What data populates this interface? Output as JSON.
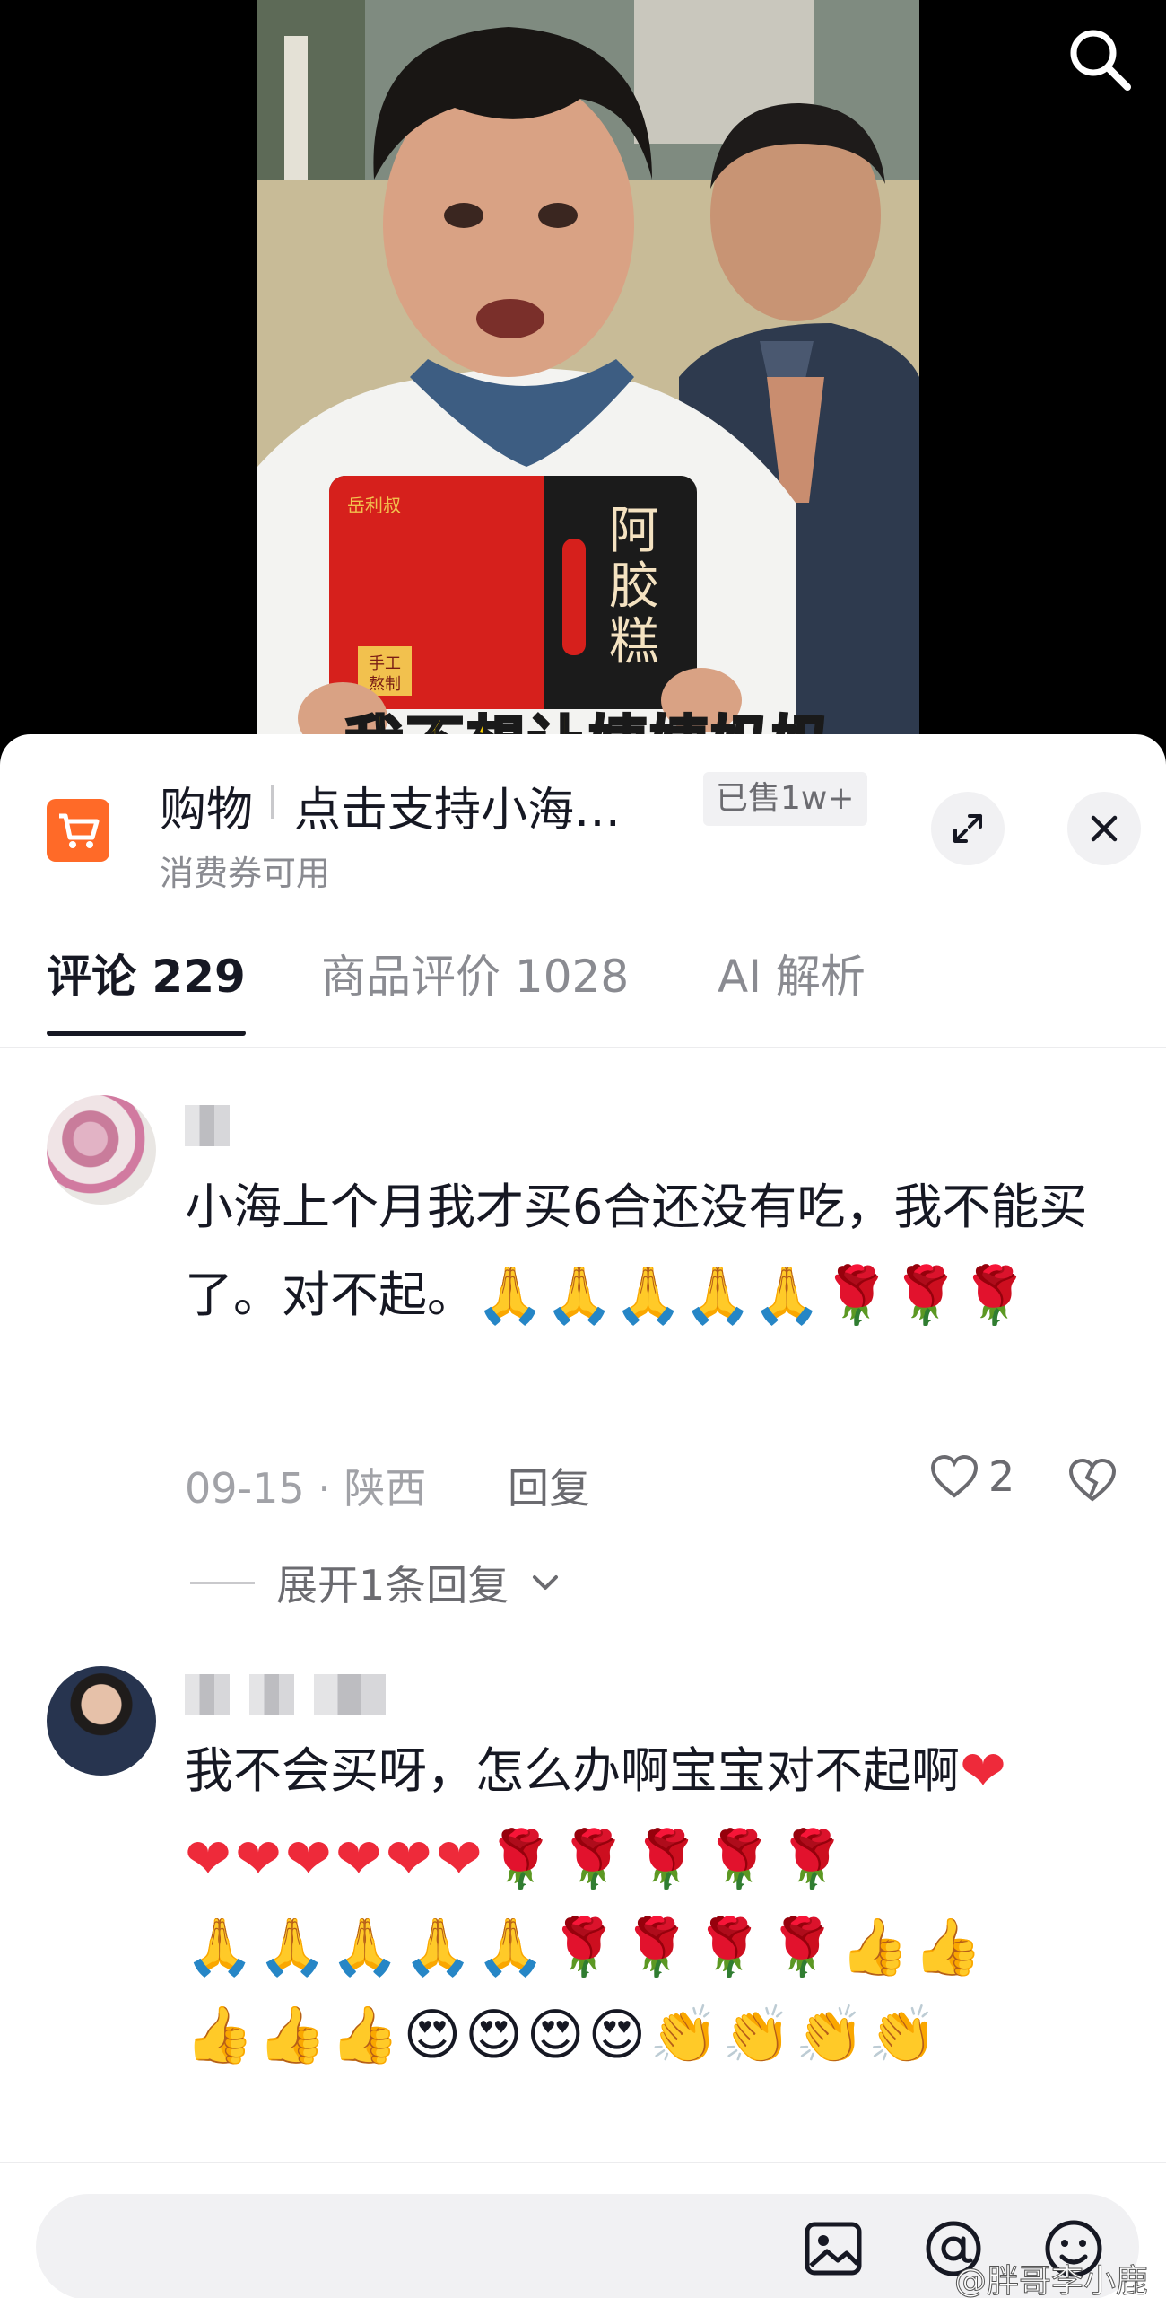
{
  "video": {
    "subtitle": "我不想让姨姨妈妈",
    "product_box": {
      "brand": "岳利叔",
      "name": "阿胶糕",
      "tag": "手工熬制",
      "sticker": "手工\n熬制"
    }
  },
  "product": {
    "tag": "购物",
    "title": "点击支持小海…",
    "sold_badge": "已售1w+",
    "coupon": "消费券可用"
  },
  "tabs": [
    {
      "label": "评论 229"
    },
    {
      "label": "商品评价 1028"
    },
    {
      "label": "AI 解析"
    }
  ],
  "comments": [
    {
      "text": "小海上个月我才买6合还没有吃，我不能买了。对不起。",
      "emojis": "🙏🙏🙏🙏🙏🌹🌹🌹",
      "date": "09-15",
      "location": "陕西",
      "reply_label": "回复",
      "likes": "2",
      "expand_label": "展开1条回复"
    },
    {
      "text": "我不会买呀，怎么办啊宝宝对不起啊",
      "emojis_line1": "❤",
      "emojis_line2": "❤❤❤❤❤❤🌹🌹🌹🌹🌹",
      "emojis_line3": "🙏🙏🙏🙏🙏🌹🌹🌹🌹👍👍",
      "emojis_line4": "👍👍👍😍😍😍😍👏👏👏👏"
    }
  ],
  "input": {
    "placeholder": ""
  },
  "watermark": "@胖哥李小鹿",
  "colors": {
    "accent_cart": "#ff6a28",
    "subtitle": "#ffd400"
  }
}
